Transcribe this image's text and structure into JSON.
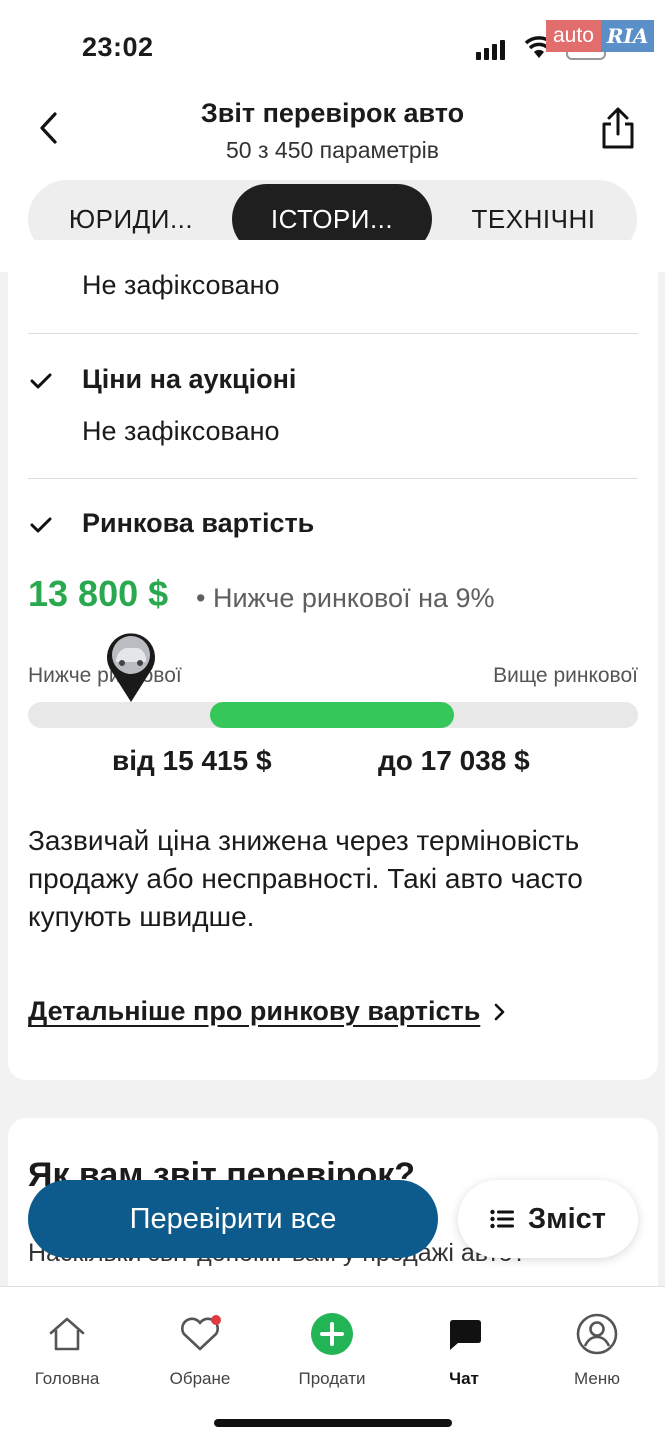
{
  "status_bar": {
    "time": "23:02"
  },
  "watermark": {
    "part1": "auto",
    "part2": "RIA"
  },
  "header": {
    "title": "Звіт перевірок авто",
    "subtitle": "50 з 450 параметрів"
  },
  "tabs": [
    {
      "label": "ЮРИДИ...",
      "active": false
    },
    {
      "label": "ІСТОРИ...",
      "active": true
    },
    {
      "label": "ТЕХНІЧНІ",
      "active": false
    }
  ],
  "report": {
    "prev_item_value": "Не зафіксовано",
    "auction": {
      "title": "Ціни на аукціоні",
      "value": "Не зафіксовано"
    },
    "market": {
      "title": "Ринкова вартість",
      "price": "13 800 $",
      "note": "• Нижче ринкової на 9%",
      "label_low": "Нижче ринкової",
      "label_high": "Вище ринкової",
      "from": "від 15 415 $",
      "to": "до 17 038 $",
      "description": "Зазвичай ціна знижена через терміновість продажу або несправності. Такі авто часто купують швидше.",
      "link": "Детальніше про ринкову вартість"
    }
  },
  "feedback": {
    "title": "Як вам звіт перевірок?",
    "question": "Наскільки звіт допоміг вам у продажі авто?"
  },
  "actions": {
    "check_all": "Перевірити все",
    "toc": "Зміст"
  },
  "nav": [
    {
      "label": "Головна",
      "icon": "home-icon"
    },
    {
      "label": "Обране",
      "icon": "heart-icon"
    },
    {
      "label": "Продати",
      "icon": "plus-circle-icon"
    },
    {
      "label": "Чат",
      "icon": "chat-icon"
    },
    {
      "label": "Меню",
      "icon": "user-circle-icon"
    }
  ],
  "colors": {
    "accent_green": "#2aa84f",
    "range_green": "#35c759",
    "primary_blue": "#0d5b8c"
  }
}
